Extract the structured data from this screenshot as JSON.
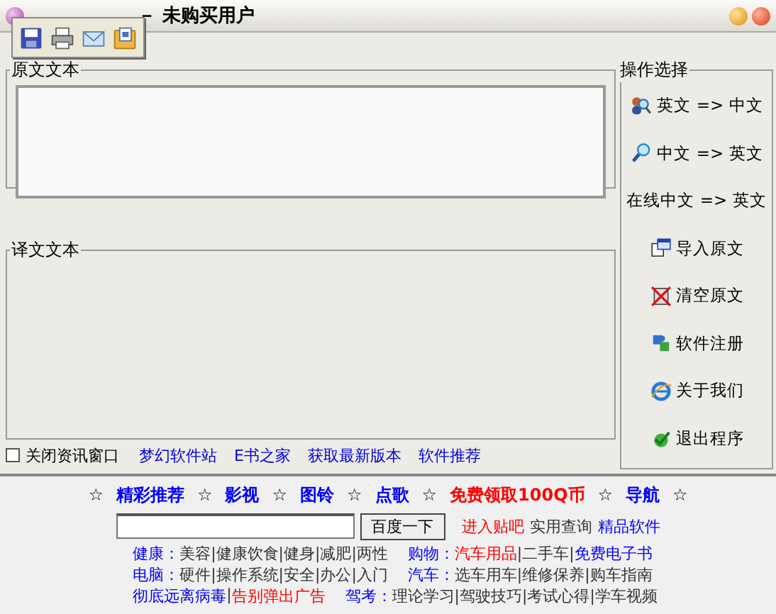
{
  "window": {
    "title": "－ 未购买用户"
  },
  "toolbar": [
    {
      "kind": "save"
    },
    {
      "kind": "print"
    },
    {
      "kind": "mail"
    },
    {
      "kind": "export"
    }
  ],
  "source_panel": {
    "label": "原文文本"
  },
  "target_panel": {
    "label": "译文文本"
  },
  "actions": {
    "label": "操作选择",
    "buttons": [
      {
        "label": "英文 => 中文",
        "kind": "person-search"
      },
      {
        "label": "中文 => 英文",
        "kind": "search"
      },
      {
        "label": "在线中文 => 英文",
        "kind": "none"
      },
      {
        "label": "导入原文",
        "kind": "import"
      },
      {
        "label": "清空原文",
        "kind": "clear"
      },
      {
        "label": "软件注册",
        "kind": "register"
      },
      {
        "label": "关于我们",
        "kind": "about"
      },
      {
        "label": "退出程序",
        "kind": "exit"
      }
    ]
  },
  "options": {
    "checkbox": {
      "label": "关闭资讯窗口",
      "checked": false
    },
    "links": [
      "梦幻软件站",
      "E书之家",
      "获取最新版本",
      "软件推荐"
    ]
  },
  "news": {
    "nav": [
      {
        "kind": "star",
        "text": "☆"
      },
      {
        "kind": "link",
        "text": "精彩推荐",
        "color": "#0000ff"
      },
      {
        "kind": "star",
        "text": "☆"
      },
      {
        "kind": "link",
        "text": "影视",
        "color": "#0000ff"
      },
      {
        "kind": "star",
        "text": "☆"
      },
      {
        "kind": "link",
        "text": "图铃",
        "color": "#0000ff"
      },
      {
        "kind": "star",
        "text": "☆"
      },
      {
        "kind": "link",
        "text": "点歌",
        "color": "#0000ff"
      },
      {
        "kind": "star",
        "text": "☆"
      },
      {
        "kind": "link",
        "text": "免费领取100Q币",
        "color": "#ff0000"
      },
      {
        "kind": "star",
        "text": "☆"
      },
      {
        "kind": "link",
        "text": "导航",
        "color": "#0000ff"
      },
      {
        "kind": "star",
        "text": "☆"
      }
    ],
    "search": {
      "button": "百度一下"
    },
    "quick_links": [
      {
        "text": "进入贴吧",
        "color": "#ff0000"
      },
      {
        "text": "实用查询",
        "color": "#333333"
      },
      {
        "text": "精品软件",
        "color": "#0000ff"
      }
    ],
    "rows": [
      {
        "left": [
          {
            "text": "健康：",
            "color": "#0000ff"
          },
          {
            "text": "美容|健康饮食|健身|减肥|两性",
            "color": "#333333"
          }
        ],
        "right": [
          {
            "text": "购物：",
            "color": "#0000ff"
          },
          {
            "text": "汽车用品",
            "color": "#ff0000"
          },
          {
            "text": "|二手车|",
            "color": "#333333"
          },
          {
            "text": "免费电子书",
            "color": "#0000ff"
          }
        ]
      },
      {
        "left": [
          {
            "text": "电脑：",
            "color": "#0000ff"
          },
          {
            "text": "硬件|操作系统|安全|办公|入门",
            "color": "#333333"
          }
        ],
        "right": [
          {
            "text": "汽车：",
            "color": "#0000ff"
          },
          {
            "text": "选车用车|维修保养|购车指南",
            "color": "#333333"
          }
        ]
      },
      {
        "left": [
          {
            "text": "彻底远离病毒",
            "color": "#0000ff"
          },
          {
            "text": "|",
            "color": "#333333"
          },
          {
            "text": "告别弹出广告",
            "color": "#ff0000"
          }
        ],
        "right": [
          {
            "text": "驾考：",
            "color": "#0000ff"
          },
          {
            "text": "理论学习|驾驶技巧|考试心得|学车视频",
            "color": "#333333"
          }
        ]
      }
    ]
  }
}
